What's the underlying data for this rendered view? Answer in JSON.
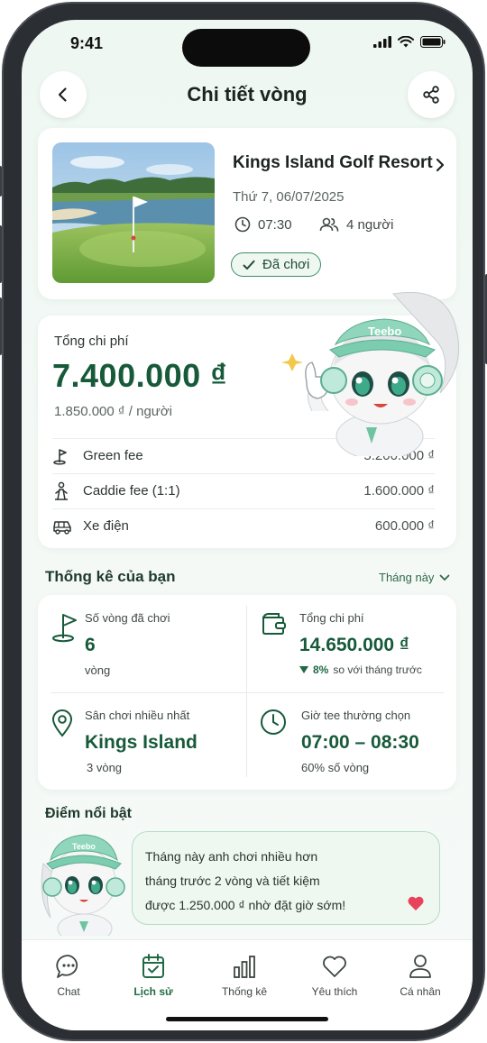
{
  "status_bar": {
    "time": "9:41"
  },
  "header": {
    "title": "Chi tiết vòng",
    "back_icon": "chevron-left-icon",
    "share_icon": "share-icon"
  },
  "course": {
    "name": "Kings Island Golf Resort",
    "date": "Thứ 7, 06/07/2025",
    "tee_time": "07:30",
    "players": "4 người",
    "status": "Đã chơi"
  },
  "cost": {
    "label": "Tổng chi phí",
    "total": "7.400.000 ₫",
    "per_person": "1.850.000 ₫ / người",
    "items": [
      {
        "name": "Green fee",
        "value": "5.200.000 ₫",
        "icon": "golf-flag-icon"
      },
      {
        "name": "Caddie fee (1:1)",
        "value": "1.600.000 ₫",
        "icon": "caddie-icon"
      },
      {
        "name": "Xe điện",
        "value": "600.000 ₫",
        "icon": "golf-cart-icon"
      }
    ]
  },
  "stats": {
    "title": "Thống kê của bạn",
    "period": "Tháng này",
    "rounds": {
      "label": "Số vòng đã chơi",
      "value": "6",
      "sub": "vòng"
    },
    "spend": {
      "label": "Tổng chi phí",
      "value": "14.650.000 ₫",
      "delta": "8%",
      "delta_text": "so với tháng trước"
    },
    "top_course": {
      "label": "Sân chơi nhiều nhất",
      "value": "Kings Island",
      "sub": "3 vòng"
    },
    "tee_time": {
      "label": "Giờ tee thường chọn",
      "value": "07:00 – 08:30",
      "sub": "60% số vòng"
    }
  },
  "highlight": {
    "title": "Điểm nổi bật",
    "lines": [
      "Tháng này anh chơi nhiều hơn",
      "tháng trước 2 vòng và tiết kiệm",
      "được 1.250.000 ₫ nhờ đặt giờ sớm!"
    ]
  },
  "mascot": {
    "cap_text": "Teebo"
  },
  "tabs": [
    {
      "label": "Chat",
      "icon": "chat-icon"
    },
    {
      "label": "Lịch sử",
      "icon": "calendar-check-icon",
      "active": true
    },
    {
      "label": "Thống kê",
      "icon": "bar-chart-icon"
    },
    {
      "label": "Yêu thích",
      "icon": "heart-icon"
    },
    {
      "label": "Cá nhân",
      "icon": "user-icon"
    }
  ],
  "colors": {
    "primary": "#175a3a",
    "accent": "#3f8d63",
    "heart": "#e8435a",
    "background": "#eef7f2"
  }
}
